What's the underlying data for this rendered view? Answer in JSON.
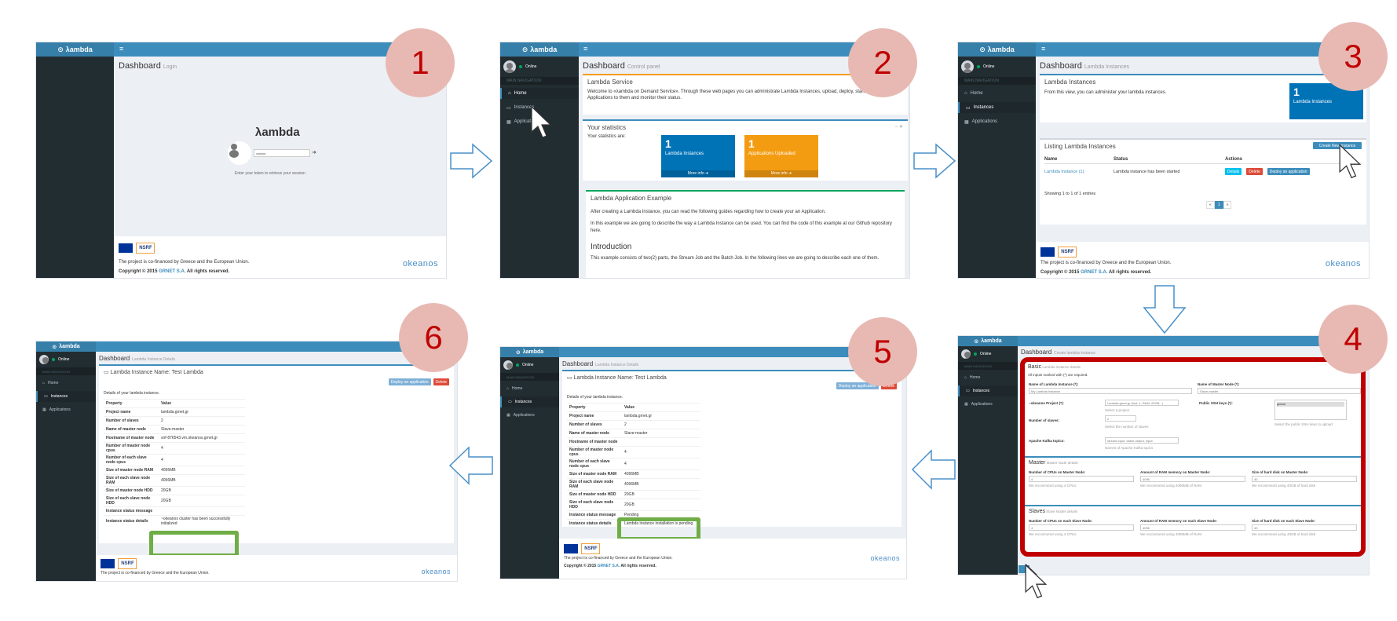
{
  "app_name": "λambda",
  "steps": [
    "1",
    "2",
    "3",
    "4",
    "5",
    "6"
  ],
  "shot1": {
    "title": "Dashboard",
    "subtitle": "Login",
    "brand": "λambda",
    "token_hint": "Enter your token to retrieve your session",
    "footer_text": "The project is co-financed by Greece and the European Union.",
    "copyright_pre": "Copyright © 2015 ",
    "copyright_link": "GRNET S.A.",
    "copyright_post": " All rights reserved.",
    "okeanos": "okeanos"
  },
  "sidebar": {
    "status": "Online",
    "section": "MAIN NAVIGATION",
    "items": [
      "Home",
      "Instances",
      "Applications"
    ]
  },
  "shot2": {
    "title": "Dashboard",
    "subtitle": "Control panel",
    "service_title": "Lambda Service",
    "service_text": "Welcome to «λambda on Demand Service». Through these web pages you can administrate Lambda Instances, upload, deploy, start and stop Applications to them and monitor their status.",
    "stats_title": "Your statistics",
    "stats_label": "Your statistics are:",
    "tile1_num": "1",
    "tile1_label": "Lambda Instances",
    "tile1_more": "More info ➜",
    "tile2_num": "1",
    "tile2_label": "Applications Uploaded",
    "tile2_more": "More info ➜",
    "example_title": "Lambda Application Example",
    "example_text1": "After creating a Lambda Instance, you can read the following guides regarding how to create your an Application.",
    "example_text2": "In this example we are going to describe the way a Lambda Instance can be used. You can find the code of this example at our Github repository here.",
    "intro_title": "Introduction",
    "intro_text": "This example consists of two(2) parts, the Stream Job and the Batch Job. In the following lines we are going to describe each one of them."
  },
  "shot3": {
    "title": "Dashboard",
    "subtitle": "Lambda Instances",
    "box_title": "Lambda Instances",
    "box_text": "From this view, you can administer your lambda instances.",
    "tile_num": "1",
    "tile_label": "Lambda Instances",
    "list_title": "Listing Lambda Instances",
    "create_btn": "Create New Instance",
    "headers": [
      "Name",
      "Status",
      "Actions"
    ],
    "row_name": "Lambda Instance (1)",
    "row_status": "Lambda instance has been started",
    "btn_details": "Details",
    "btn_delete": "Delete",
    "btn_deploy": "Deploy an application",
    "showing": "Showing 1 to 1 of 1 entries",
    "pages": [
      "«",
      "1",
      "»"
    ]
  },
  "shot4": {
    "title": "Dashboard",
    "subtitle": "Create lambda instance",
    "basic": "Basic",
    "basic_sub": "Lambda instance details",
    "required": "All inputs marked with (*) are required.",
    "name_label": "Name of Lambda Instance (*):",
    "name_value": "My Lambda Instance",
    "master_label": "Name of Master Node (*):",
    "master_value": "Slave-master",
    "project_label": "~okeanos Project (*):",
    "project_value": "Lambda.grnet.gr (Inst: 1, RAM: 20GB...)",
    "project_hint": "Select a project",
    "slaves_label": "Number of slaves:",
    "slaves_value": "2",
    "slaves_hint": "Select the number of slaves",
    "ssh_label": "Public SSH keys (*):",
    "ssh_value": "global",
    "ssh_hint": "Select the public SSH keys to upload",
    "kafka_label": "Apache Kafka topics:",
    "kafka_value": "stream-input, batch-output, input",
    "kafka_hint": "Names of Apache Kafka topics",
    "master_section": "Master",
    "master_sub": "Master Node details",
    "slaves_section": "Slaves",
    "slaves_sub": "Slave Nodes details",
    "cpu_master": "Number of CPUs on Master Node:",
    "ram_master": "Amount of RAM memory on Master Node:",
    "disk_master": "Size of hard disk on Master Node:",
    "cpu_slave": "Number of CPUs on each Slave Node:",
    "ram_slave": "Amount of RAM memory on each Slave Node:",
    "disk_slave": "Size of hard disk on each Slave Node:",
    "cpu_val": "4",
    "ram_val": "4096",
    "disk_val": "40",
    "cpu_hint": "We recommend using 4 CPUs",
    "ram_hint": "We recommend using 4096MB of RAM",
    "disk_hint": "We recommend using 40GB of hard disk"
  },
  "shot5": {
    "title": "Dashboard",
    "subtitle": "Lambda Instance Details",
    "name_label": "Lambda Instance Name: Test Lambda",
    "btn_deploy": "Deploy an application",
    "btn_delete": "Delete",
    "details_label": "Details of your lambda instance.",
    "headers": [
      "Property",
      "Value"
    ],
    "rows": [
      [
        "Project name",
        "lambda.grnet.gr"
      ],
      [
        "Number of slaves",
        "2"
      ],
      [
        "Name of master node",
        "Slave-master"
      ],
      [
        "Hostname of master node",
        ""
      ],
      [
        "Number of master node cpus",
        "4"
      ],
      [
        "Number of each slave node cpus",
        "4"
      ],
      [
        "Size of master node RAM",
        "4096MB"
      ],
      [
        "Size of each slave node RAM",
        "4096MB"
      ],
      [
        "Size of master node HDD",
        "20GB"
      ],
      [
        "Size of each slave node HDD",
        "20GB"
      ],
      [
        "Instance status message",
        "Pending"
      ],
      [
        "Instance status details",
        "Lambda instance installation is pending"
      ]
    ],
    "footer_text": "The project is co-financed by Greece and the European Union.",
    "copyright_pre": "Copyright © 2015 ",
    "copyright_link": "GRNET S.A.",
    "copyright_post": " All rights reserved.",
    "okeanos": "okeanos"
  },
  "shot6": {
    "title": "Dashboard",
    "subtitle": "Lambda Instance Details",
    "name_label": "Lambda Instance Name: Test Lambda",
    "btn_deploy": "Deploy an application",
    "btn_delete": "Delete",
    "details_label": "Details of your lambda instance.",
    "headers": [
      "Property",
      "Value"
    ],
    "rows": [
      [
        "Project name",
        "lambda.grnet.gr"
      ],
      [
        "Number of slaves",
        "2"
      ],
      [
        "Name of master node",
        "Slave-master"
      ],
      [
        "Hostname of master node",
        "snf-876543.vm.okeanos.grnet.gr"
      ],
      [
        "Number of master node cpus",
        "4"
      ],
      [
        "Number of each slave node cpus",
        "4"
      ],
      [
        "Size of master node RAM",
        "4096MB"
      ],
      [
        "Size of each slave node RAM",
        "4096MB"
      ],
      [
        "Size of master node HDD",
        "20GB"
      ],
      [
        "Size of each slave node HDD",
        "20GB"
      ],
      [
        "Instance status message",
        ""
      ],
      [
        "Instance status details",
        "~okeanos cluster has been successfully initialized"
      ]
    ],
    "footer_text": "The project is co-financed by Greece and the European Union.",
    "okeanos": "okeanos"
  },
  "colors": {
    "header": "#3c8dbc",
    "sidebar": "#222d32",
    "step_circle": "#e8b9b3",
    "step_number": "#c00000",
    "highlight_green": "#70ad47",
    "highlight_red": "#c00000",
    "arrow": "#4a90c8"
  }
}
